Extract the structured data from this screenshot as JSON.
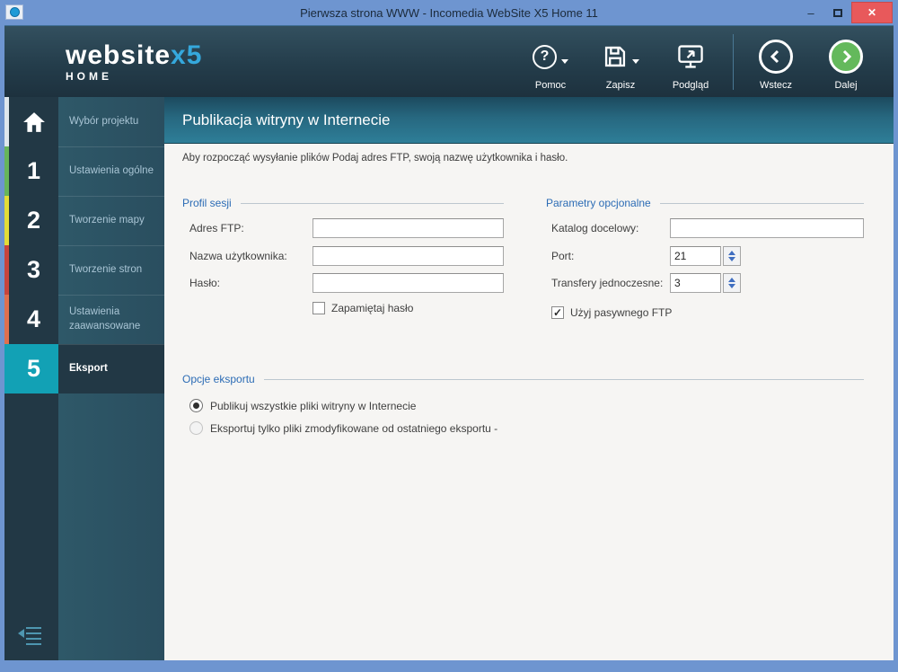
{
  "window": {
    "title": "Pierwsza strona WWW - Incomedia WebSite X5 Home 11",
    "controls": {
      "minimize": "–",
      "close": "✕"
    }
  },
  "toolbar": {
    "brand": {
      "main": "website",
      "x5": "x5",
      "sub": "HOME"
    },
    "help_label": "Pomoc",
    "save_label": "Zapisz",
    "preview_label": "Podgląd",
    "back_label": "Wstecz",
    "next_label": "Dalej"
  },
  "sidebar": {
    "items": [
      {
        "number": "",
        "label": "Wybór projektu",
        "strip_color": "#dfe7ec",
        "selected": false
      },
      {
        "number": "1",
        "label": "Ustawienia ogólne",
        "strip_color": "#67b55b",
        "selected": false
      },
      {
        "number": "2",
        "label": "Tworzenie mapy",
        "strip_color": "#e3dd37",
        "selected": false
      },
      {
        "number": "3",
        "label": "Tworzenie stron",
        "strip_color": "#c8453c",
        "selected": false
      },
      {
        "number": "4",
        "label": "Ustawienia zaawansowane",
        "strip_color": "#e0704e",
        "selected": false
      },
      {
        "number": "5",
        "label": "Eksport",
        "strip_color": "#12a1b5",
        "selected": true
      }
    ]
  },
  "main": {
    "header": "Publikacja witryny w Internecie",
    "description": "Aby rozpocząć wysyłanie plików Podaj adres FTP, swoją nazwę użytkownika i hasło.",
    "session": {
      "title": "Profil sesji",
      "ftp_label": "Adres FTP:",
      "ftp_value": "",
      "user_label": "Nazwa użytkownika:",
      "user_value": "",
      "password_label": "Hasło:",
      "password_value": "",
      "remember_label": "Zapamiętaj hasło",
      "remember_checked": false
    },
    "optional": {
      "title": "Parametry opcjonalne",
      "dir_label": "Katalog docelowy:",
      "dir_value": "",
      "port_label": "Port:",
      "port_value": "21",
      "transfers_label": "Transfery jednoczesne:",
      "transfers_value": "3",
      "passive_label": "Użyj pasywnego FTP",
      "passive_checked": true,
      "check_mark": "✓"
    },
    "export_options": {
      "title": "Opcje eksportu",
      "option_all": "Publikuj wszystkie pliki witryny w Internecie",
      "option_modified": "Eksportuj tylko pliki zmodyfikowane od ostatniego eksportu -",
      "selected": "option_all"
    }
  },
  "colors": {
    "titlebar": "#6e95d0",
    "toolbar_dark": "#1d313e",
    "accent_cyan": "#35a8dc",
    "selected_step": "#12a1b5",
    "header_teal": "#2e7e98",
    "next_green": "#64b95c",
    "close_red": "#e8595b",
    "section_blue": "#2c6cb5"
  }
}
